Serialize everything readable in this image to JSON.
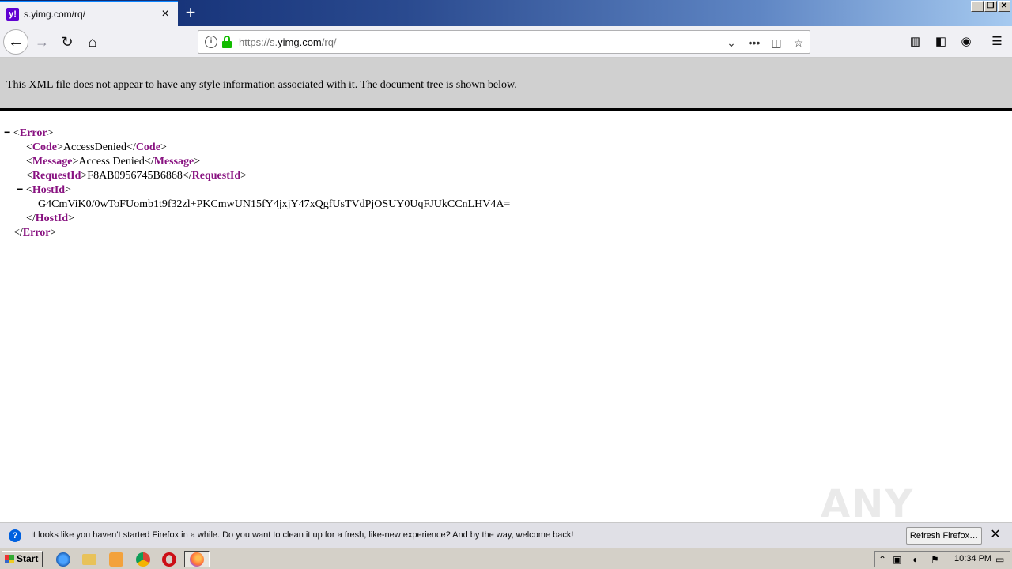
{
  "browser": {
    "tab_title": "s.yimg.com/rq/",
    "favicon_letter": "y!",
    "new_tab": "+",
    "window_controls": [
      "_",
      "❐",
      "✕"
    ],
    "url_prefix": "https://s.",
    "url_domain": "yimg.com",
    "url_path": "/rq/",
    "icons": [
      "back-arrow-icon",
      "forward-arrow-icon",
      "reload-icon",
      "home-icon",
      "info-icon",
      "lock-icon",
      "chevron-down-icon",
      "more-icon",
      "pocket-icon",
      "star-icon",
      "library-icon",
      "sidebar-icon",
      "account-icon",
      "menu-icon"
    ]
  },
  "xml_info": "This XML file does not appear to have any style information associated with it. The document tree is shown below.",
  "xml": {
    "root_tag": "Error",
    "code_tag": "Code",
    "code_value": "AccessDenied",
    "message_tag": "Message",
    "message_value": "Access Denied",
    "requestid_tag": "RequestId",
    "requestid_value": "F8AB0956745B6868",
    "hostid_tag": "HostId",
    "hostid_value": "G4CmViK0/0wToFUomb1t9f32zl+PKCmwUN15fY4jxjY47xQgfUsTVdPjOSUY0UqFJUkCCnLHV4A=",
    "toggle": "−"
  },
  "watermark": "ANY RUN",
  "notification": {
    "message": "It looks like you haven’t started Firefox in a while. Do you want to clean it up for a fresh, like-new experience? And by the way, welcome back!",
    "refresh_label": "Refresh Firefox…",
    "close": "✕"
  },
  "taskbar": {
    "start_label": "Start",
    "clock": "10:34 PM",
    "apps": [
      "internet-explorer-icon",
      "folder-icon",
      "media-player-icon",
      "chrome-icon",
      "opera-icon",
      "firefox-icon"
    ]
  }
}
